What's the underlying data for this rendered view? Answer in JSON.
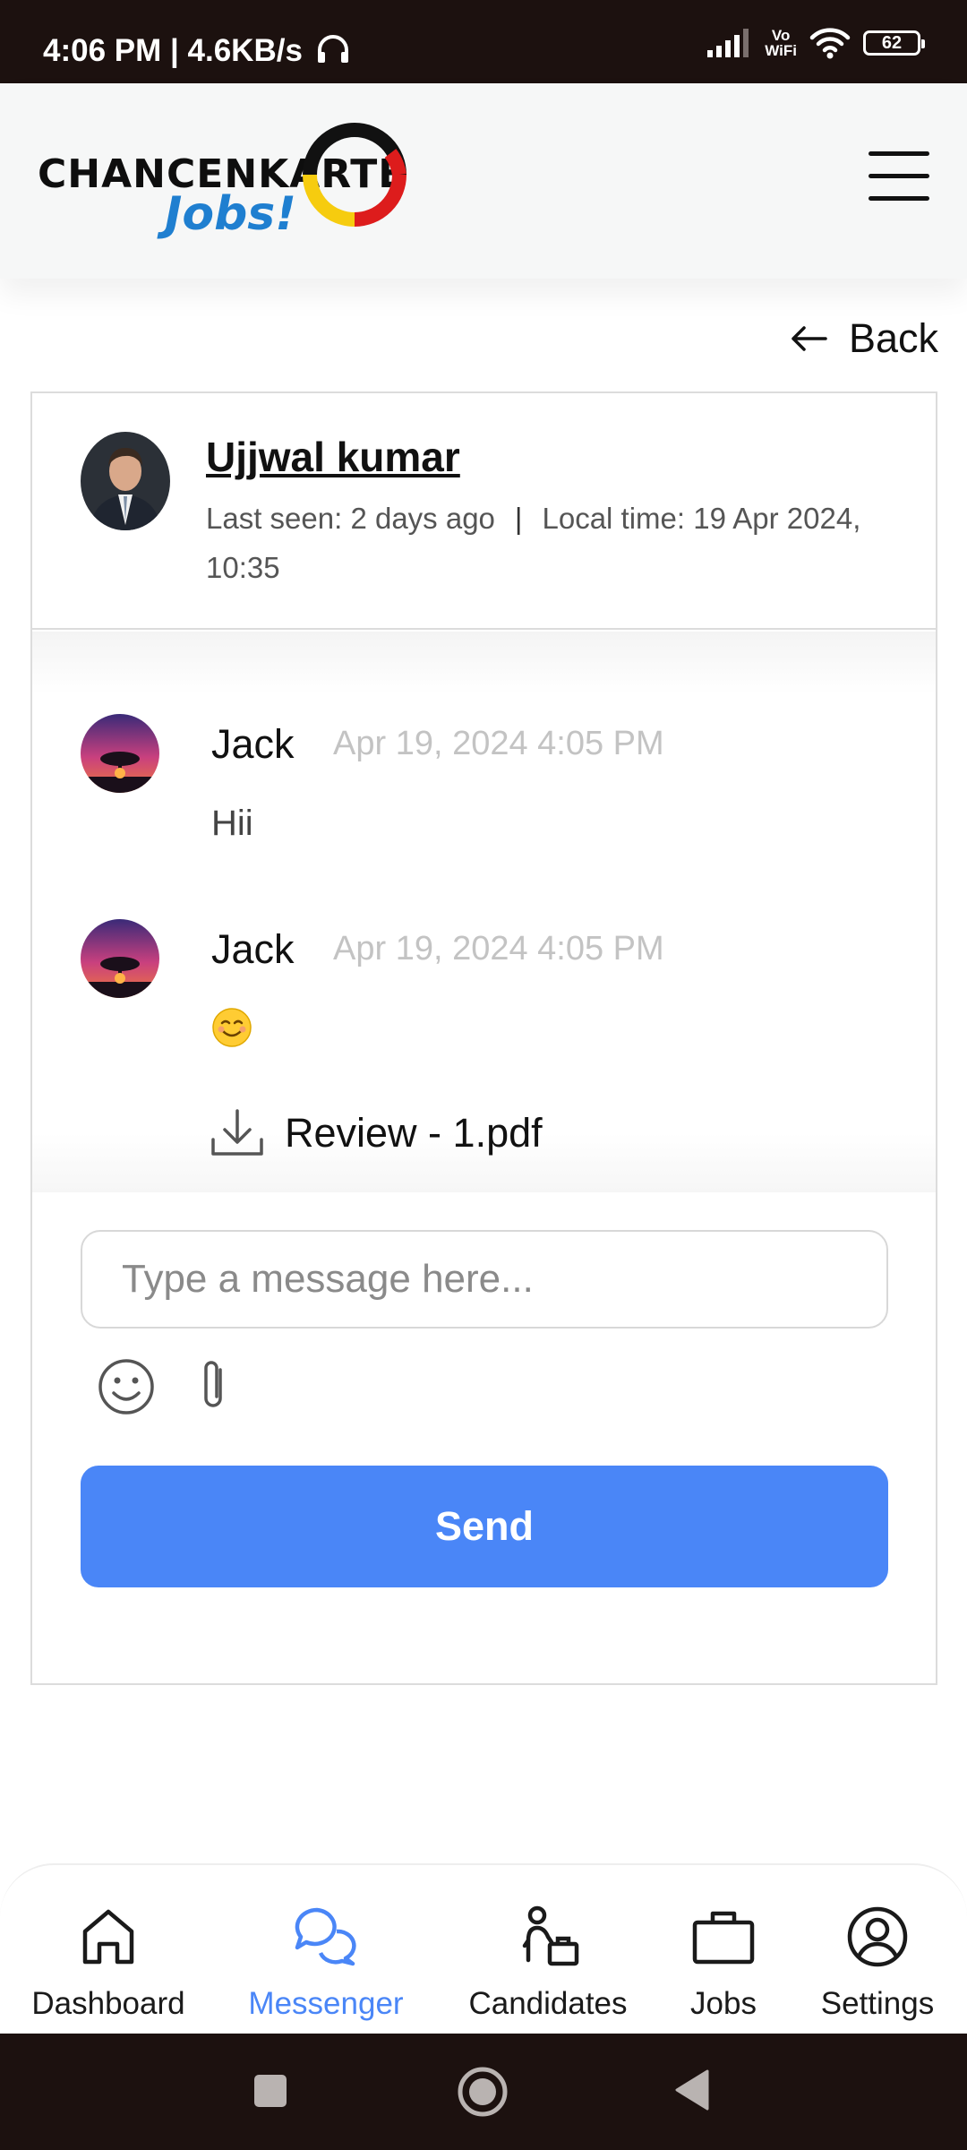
{
  "status_bar": {
    "time_speed": "4:06 PM | 4.6KB/s",
    "vowifi_top": "Vo",
    "vowifi_bottom": "WiFi",
    "battery": "62"
  },
  "header": {
    "logo_line1": "CHANCENKARTE",
    "logo_line2": "Jobs!",
    "menu_icon": "hamburger-icon"
  },
  "back_label": "Back",
  "contact": {
    "name": "Ujjwal kumar",
    "last_seen": "Last seen: 2 days ago",
    "separator": "|",
    "local_time": "Local time: 19 Apr 2024, 10:35"
  },
  "messages": [
    {
      "author": "Jack",
      "time": "Apr 19, 2024 4:05 PM",
      "text": "Hii"
    },
    {
      "author": "Jack",
      "time": "Apr 19, 2024 4:05 PM",
      "emoji": "😊",
      "attachment": "Review - 1.pdf"
    }
  ],
  "composer": {
    "placeholder": "Type a message here...",
    "send_label": "Send"
  },
  "bottom_nav": [
    {
      "label": "Dashboard",
      "icon": "home-icon"
    },
    {
      "label": "Messenger",
      "icon": "chat-bubbles-icon",
      "active": true
    },
    {
      "label": "Candidates",
      "icon": "candidate-briefcase-icon"
    },
    {
      "label": "Jobs",
      "icon": "briefcase-icon"
    },
    {
      "label": "Settings",
      "icon": "user-circle-icon"
    }
  ],
  "colors": {
    "accent": "#4a86f7",
    "system_bar": "#1c110f",
    "logo_blue": "#1f7fd0"
  }
}
